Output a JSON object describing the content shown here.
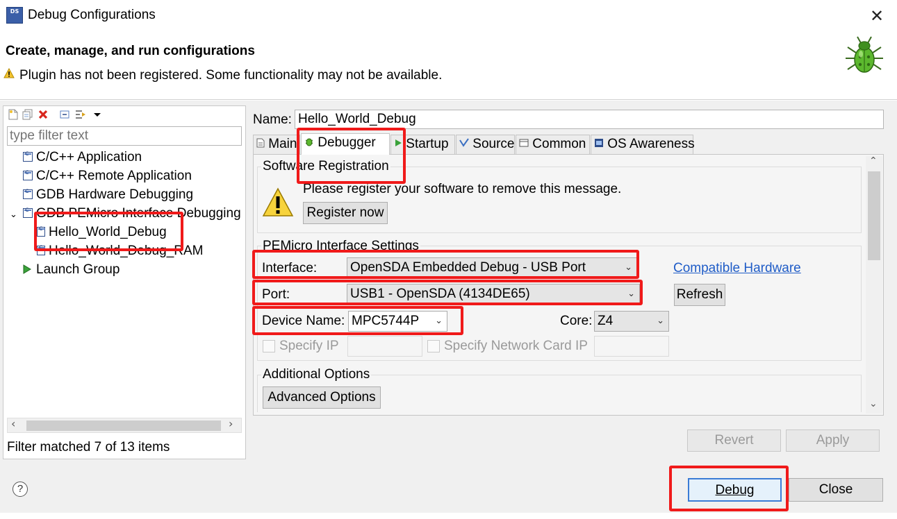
{
  "window": {
    "title": "Debug Configurations",
    "close_glyph": "✕",
    "icon_text": "DS"
  },
  "banner": {
    "title": "Create, manage, and run configurations",
    "warning": "Plugin has not been registered. Some functionality may not be available.",
    "icon": "bug-icon"
  },
  "left": {
    "toolbar_icons": [
      "new-config-icon",
      "duplicate-icon",
      "delete-icon",
      "collapse-all-icon",
      "filter-icon",
      "dropdown-icon"
    ],
    "filter_placeholder": "type filter text",
    "tree": [
      {
        "label": "C/C++ Application",
        "icon": "c-config-icon"
      },
      {
        "label": "C/C++ Remote Application",
        "icon": "c-config-icon"
      },
      {
        "label": "GDB Hardware Debugging",
        "icon": "c-config-icon"
      },
      {
        "label": "GDB PEMicro Interface Debugging",
        "icon": "c-config-icon",
        "expanded": true
      },
      {
        "label": "Hello_World_Debug",
        "icon": "c-file-icon",
        "child": true,
        "selected": true
      },
      {
        "label": "Hello_World_Debug_RAM",
        "icon": "c-file-icon",
        "child": true
      },
      {
        "label": "Launch Group",
        "icon": "launch-group-icon"
      }
    ],
    "status": "Filter matched 7 of 13 items"
  },
  "config": {
    "name_label": "Name:",
    "name_value": "Hello_World_Debug",
    "tabs": [
      {
        "label": "Main",
        "icon": "main-tab-icon"
      },
      {
        "label": "Debugger",
        "icon": "debugger-tab-icon",
        "active": true
      },
      {
        "label": "Startup",
        "icon": "startup-tab-icon"
      },
      {
        "label": "Source",
        "icon": "source-tab-icon"
      },
      {
        "label": "Common",
        "icon": "common-tab-icon"
      },
      {
        "label": "OS Awareness",
        "icon": "os-awareness-tab-icon"
      }
    ],
    "software_registration": {
      "group_label": "Software Registration",
      "message": "Please register your software to remove this message.",
      "button": "Register now"
    },
    "interface_settings": {
      "group_label": "PEMicro Interface Settings",
      "interface_label": "Interface:",
      "interface_value": "OpenSDA Embedded Debug - USB Port",
      "compatible_link": "Compatible Hardware",
      "port_label": "Port:",
      "port_value": "USB1 - OpenSDA (4134DE65)",
      "refresh_button": "Refresh",
      "device_label": "Device Name:",
      "device_value": "MPC5744P",
      "core_label": "Core:",
      "core_value": "Z4",
      "specify_ip_label": "Specify IP",
      "specify_nic_label": "Specify Network Card IP"
    },
    "additional": {
      "group_label": "Additional Options",
      "button": "Advanced Options"
    },
    "revert_button": "Revert",
    "apply_button": "Apply"
  },
  "footer": {
    "help_glyph": "?",
    "debug_button": "Debug",
    "close_button": "Close"
  },
  "colors": {
    "highlight": "#f01a1a",
    "link": "#1f5cc7",
    "dialog_bg": "#f0f0f0"
  }
}
